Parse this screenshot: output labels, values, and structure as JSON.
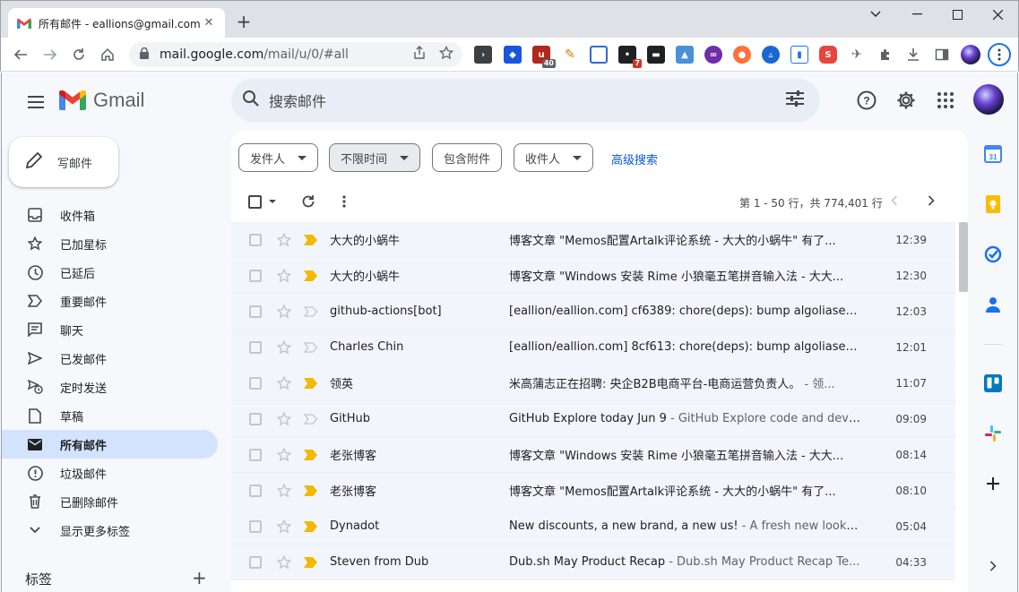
{
  "browser": {
    "tab_title": "所有邮件 - eallions@gmail.com",
    "url_host": "mail.google.com",
    "url_path": "/mail/u/0/#all",
    "ext_badge_1": "40",
    "ext_badge_2": "7"
  },
  "header": {
    "brand": "Gmail",
    "search_placeholder": "搜索邮件"
  },
  "compose_label": "写邮件",
  "nav": [
    {
      "label": "收件箱",
      "icon": "inbox-icon"
    },
    {
      "label": "已加星标",
      "icon": "star-icon"
    },
    {
      "label": "已延后",
      "icon": "clock-icon"
    },
    {
      "label": "重要邮件",
      "icon": "important-icon"
    },
    {
      "label": "聊天",
      "icon": "chat-icon"
    },
    {
      "label": "已发邮件",
      "icon": "send-icon"
    },
    {
      "label": "定时发送",
      "icon": "scheduled-send-icon"
    },
    {
      "label": "草稿",
      "icon": "draft-icon"
    },
    {
      "label": "所有邮件",
      "icon": "all-mail-icon"
    },
    {
      "label": "垃圾邮件",
      "icon": "spam-icon"
    },
    {
      "label": "已删除邮件",
      "icon": "trash-icon"
    },
    {
      "label": "显示更多标签",
      "icon": "chevron-down-icon"
    }
  ],
  "labels_header": "标签",
  "filters": {
    "from": "发件人",
    "any_time": "不限时间",
    "has_attachment": "包含附件",
    "to": "收件人",
    "advanced": "高级搜索"
  },
  "pager_text": "第 1 - 50 行，共 774,401 行",
  "emails": [
    {
      "sender": "大大的小蜗牛",
      "subject": "博客文章 \"Memos配置Artalk评论系统 - 大大的小蜗牛\" 有了...",
      "snippet": "",
      "time": "12:39",
      "important": true
    },
    {
      "sender": "大大的小蜗牛",
      "subject": "博客文章 \"Windows 安装 Rime 小狼毫五笔拼音输入法 - 大大...",
      "snippet": "",
      "time": "12:30",
      "important": true
    },
    {
      "sender": "github-actions[bot]",
      "subject": "[eallion/eallion.com] cf6389: chore(deps): bump algoliasear...",
      "snippet": "",
      "time": "12:03",
      "important": false
    },
    {
      "sender": "Charles Chin",
      "subject": "[eallion/eallion.com] 8cf613: chore(deps): bump algoliasearc...",
      "snippet": "",
      "time": "12:01",
      "important": false
    },
    {
      "sender": "领英",
      "subject": "米高蒲志正在招聘: 央企B2B电商平台-电商运营负责人。",
      "snippet": " - 领...",
      "time": "11:07",
      "important": true
    },
    {
      "sender": "GitHub",
      "subject": "GitHub Explore today Jun 9",
      "snippet": " - GitHub Explore code and deve...",
      "time": "09:09",
      "important": false
    },
    {
      "sender": "老张博客",
      "subject": "博客文章 \"Windows 安装 Rime 小狼毫五笔拼音输入法 - 大大...",
      "snippet": "",
      "time": "08:14",
      "important": true
    },
    {
      "sender": "老张博客",
      "subject": "博客文章 \"Memos配置Artalk评论系统 - 大大的小蜗牛\" 有了...",
      "snippet": "",
      "time": "08:10",
      "important": true
    },
    {
      "sender": "Dynadot",
      "subject": "New discounts, a new brand, a new us!",
      "snippet": " - A fresh new look to...",
      "time": "05:04",
      "important": true
    },
    {
      "sender": "Steven from Dub",
      "subject": "Dub.sh May Product Recap",
      "snippet": " - Dub.sh May Product Recap Te...",
      "time": "04:33",
      "important": true
    }
  ],
  "colors": {
    "accent": "#0b57d0",
    "important": "#f2b900",
    "active_nav": "#d3e3fd"
  }
}
